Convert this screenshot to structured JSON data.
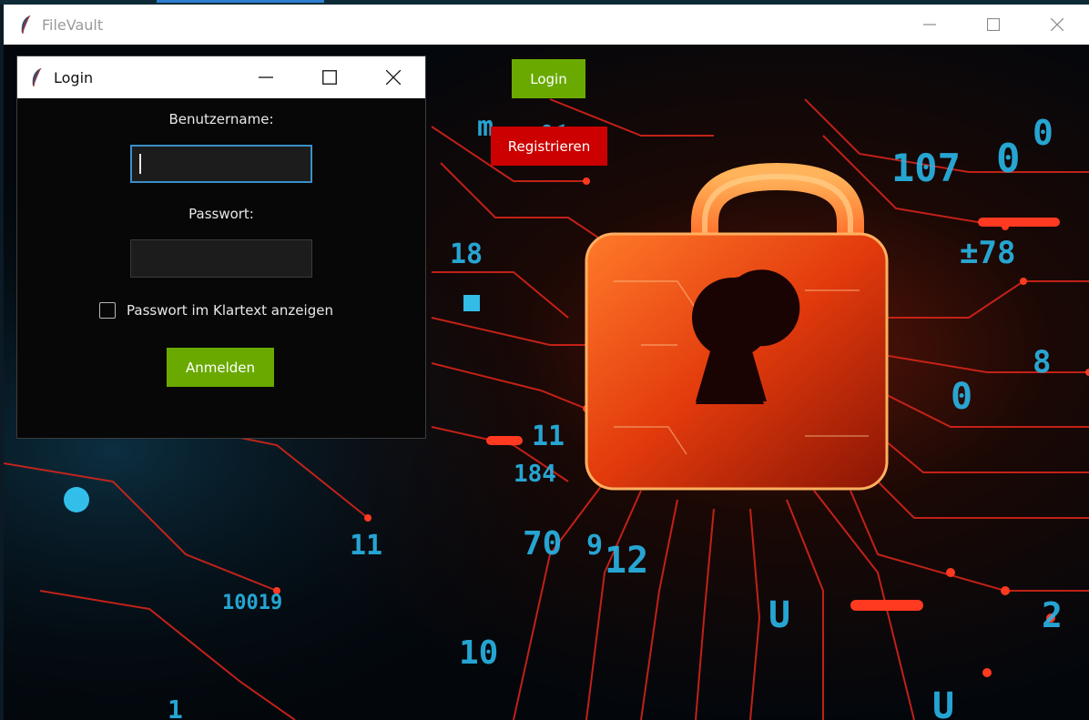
{
  "window": {
    "title": "FileVault",
    "controls": [
      "minimize-icon",
      "maximize-icon",
      "close-icon"
    ]
  },
  "toolbar": {
    "login_label": "Login",
    "register_label": "Registrieren"
  },
  "login_dialog": {
    "title": "Login",
    "username_label": "Benutzername:",
    "username_value": "",
    "password_label": "Passwort:",
    "password_value": "",
    "show_password_label": "Passwort im Klartext anzeigen",
    "show_password_checked": false,
    "submit_label": "Anmelden"
  },
  "colors": {
    "login_button": "#6aaa00",
    "register_button": "#cc0000",
    "submit_button": "#6aaa00",
    "focus_border": "#3a8fc8",
    "dialog_background": "#070707"
  },
  "background": {
    "description_icon": "padlock-circuit-image"
  }
}
